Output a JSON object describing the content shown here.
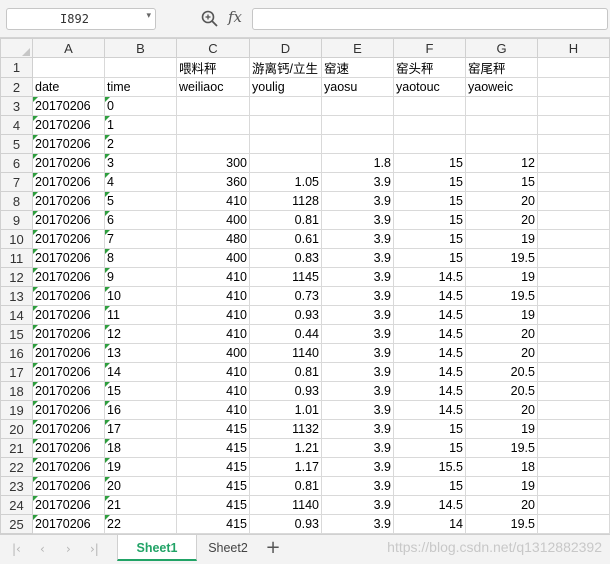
{
  "formula_bar": {
    "name_box": "I892",
    "formula_value": ""
  },
  "icons": [
    "zoom-icon",
    "fx-icon",
    "chevron-down-icon",
    "add-icon"
  ],
  "columns": [
    "A",
    "B",
    "C",
    "D",
    "E",
    "F",
    "G",
    "H"
  ],
  "rows": [
    {
      "n": "1",
      "cells": [
        "",
        "",
        "喂料秤",
        "游离钙/立生",
        "窑速",
        "窑头秤",
        "窑尾秤",
        ""
      ]
    },
    {
      "n": "2",
      "cells": [
        "date",
        "time",
        "weiliaoc",
        "youlig",
        "yaosu",
        "yaotouc",
        "yaoweic",
        ""
      ]
    },
    {
      "n": "3",
      "cells": [
        "20170206",
        "0",
        "",
        "",
        "",
        "",
        "",
        ""
      ]
    },
    {
      "n": "4",
      "cells": [
        "20170206",
        "1",
        "",
        "",
        "",
        "",
        "",
        ""
      ]
    },
    {
      "n": "5",
      "cells": [
        "20170206",
        "2",
        "",
        "",
        "",
        "",
        "",
        ""
      ]
    },
    {
      "n": "6",
      "cells": [
        "20170206",
        "3",
        "300",
        "",
        "1.8",
        "15",
        "12",
        ""
      ]
    },
    {
      "n": "7",
      "cells": [
        "20170206",
        "4",
        "360",
        "1.05",
        "3.9",
        "15",
        "15",
        ""
      ]
    },
    {
      "n": "8",
      "cells": [
        "20170206",
        "5",
        "410",
        "1128",
        "3.9",
        "15",
        "20",
        ""
      ]
    },
    {
      "n": "9",
      "cells": [
        "20170206",
        "6",
        "400",
        "0.81",
        "3.9",
        "15",
        "20",
        ""
      ]
    },
    {
      "n": "10",
      "cells": [
        "20170206",
        "7",
        "480",
        "0.61",
        "3.9",
        "15",
        "19",
        ""
      ]
    },
    {
      "n": "11",
      "cells": [
        "20170206",
        "8",
        "400",
        "0.83",
        "3.9",
        "15",
        "19.5",
        ""
      ]
    },
    {
      "n": "12",
      "cells": [
        "20170206",
        "9",
        "410",
        "1145",
        "3.9",
        "14.5",
        "19",
        ""
      ]
    },
    {
      "n": "13",
      "cells": [
        "20170206",
        "10",
        "410",
        "0.73",
        "3.9",
        "14.5",
        "19.5",
        ""
      ]
    },
    {
      "n": "14",
      "cells": [
        "20170206",
        "11",
        "410",
        "0.93",
        "3.9",
        "14.5",
        "19",
        ""
      ]
    },
    {
      "n": "15",
      "cells": [
        "20170206",
        "12",
        "410",
        "0.44",
        "3.9",
        "14.5",
        "20",
        ""
      ]
    },
    {
      "n": "16",
      "cells": [
        "20170206",
        "13",
        "400",
        "1140",
        "3.9",
        "14.5",
        "20",
        ""
      ]
    },
    {
      "n": "17",
      "cells": [
        "20170206",
        "14",
        "410",
        "0.81",
        "3.9",
        "14.5",
        "20.5",
        ""
      ]
    },
    {
      "n": "18",
      "cells": [
        "20170206",
        "15",
        "410",
        "0.93",
        "3.9",
        "14.5",
        "20.5",
        ""
      ]
    },
    {
      "n": "19",
      "cells": [
        "20170206",
        "16",
        "410",
        "1.01",
        "3.9",
        "14.5",
        "20",
        ""
      ]
    },
    {
      "n": "20",
      "cells": [
        "20170206",
        "17",
        "415",
        "1132",
        "3.9",
        "15",
        "19",
        ""
      ]
    },
    {
      "n": "21",
      "cells": [
        "20170206",
        "18",
        "415",
        "1.21",
        "3.9",
        "15",
        "19.5",
        ""
      ]
    },
    {
      "n": "22",
      "cells": [
        "20170206",
        "19",
        "415",
        "1.17",
        "3.9",
        "15.5",
        "18",
        ""
      ]
    },
    {
      "n": "23",
      "cells": [
        "20170206",
        "20",
        "415",
        "0.81",
        "3.9",
        "15",
        "19",
        ""
      ]
    },
    {
      "n": "24",
      "cells": [
        "20170206",
        "21",
        "415",
        "1140",
        "3.9",
        "14.5",
        "20",
        ""
      ]
    },
    {
      "n": "25",
      "cells": [
        "20170206",
        "22",
        "415",
        "0.93",
        "3.9",
        "14",
        "19.5",
        ""
      ]
    }
  ],
  "sheets": {
    "nav_first": "|‹",
    "nav_prev": "‹",
    "nav_next": "›",
    "nav_last": "›|",
    "tabs": [
      "Sheet1",
      "Sheet2"
    ],
    "active_tab": "Sheet1",
    "add_label": "+"
  },
  "watermark": "https://blog.csdn.net/q1312882392",
  "colors": {
    "active_tab": "#21a366",
    "text_cell_marker": "#2e9e3e"
  }
}
